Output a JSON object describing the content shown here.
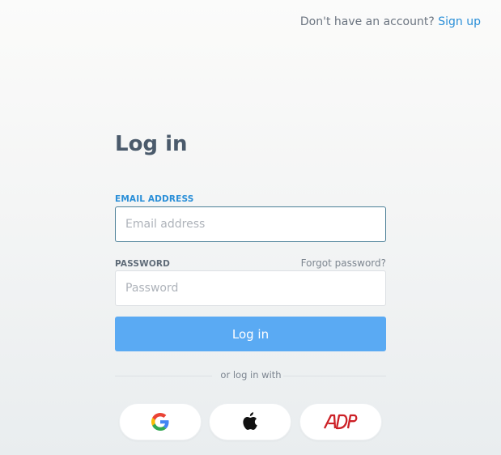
{
  "header": {
    "signup_prompt": "Don't have an account?",
    "signup_link": "Sign up"
  },
  "login": {
    "title": "Log in",
    "email": {
      "label": "EMAIL ADDRESS",
      "value": "",
      "placeholder": "Email address"
    },
    "password": {
      "label": "PASSWORD",
      "value": "",
      "placeholder": "Password",
      "forgot_link": "Forgot password?"
    },
    "submit_label": "Log in",
    "divider_text": "or log in with"
  },
  "social": {
    "buttons": [
      {
        "icon": "google-logo-icon"
      },
      {
        "icon": "apple-logo-icon"
      },
      {
        "icon": "adp-logo-icon"
      }
    ]
  },
  "colors": {
    "accent": "#2a8fd8",
    "button_blue": "#5aaaf3",
    "heading_text": "#4a5a6b"
  }
}
